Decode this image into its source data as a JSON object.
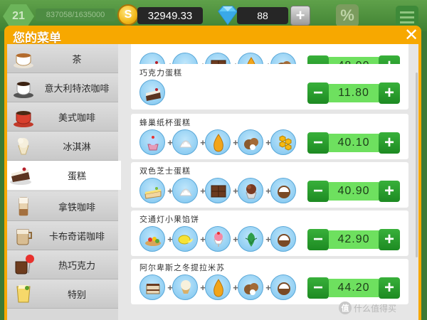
{
  "topbar": {
    "level": "21",
    "xp": "837058/1635000",
    "coins": "32949.33",
    "coin_symbol": "S",
    "gems": "88",
    "plus": "+",
    "percent": "%"
  },
  "dialog": {
    "title": "您的菜单",
    "close": "✕"
  },
  "sidebar": {
    "items": [
      {
        "label": "茶",
        "icon": "tea-cup-icon"
      },
      {
        "label": "意大利特浓咖啡",
        "icon": "espresso-cup-icon"
      },
      {
        "label": "美式咖啡",
        "icon": "coffee-cup-icon"
      },
      {
        "label": "冰淇淋",
        "icon": "ice-cream-icon"
      },
      {
        "label": "蛋糕",
        "icon": "cake-icon",
        "active": true
      },
      {
        "label": "拿铁咖啡",
        "icon": "latte-icon"
      },
      {
        "label": "卡布奇诺咖啡",
        "icon": "cappuccino-icon"
      },
      {
        "label": "热巧克力",
        "icon": "hot-chocolate-icon"
      },
      {
        "label": "特别",
        "icon": "special-drink-icon"
      }
    ]
  },
  "recipes": [
    {
      "name": "",
      "price": "48.90",
      "ingredients": [
        "cake-icon",
        "cream-icon",
        "chocolate-icon",
        "syrup-icon",
        "hazelnut-icon"
      ]
    },
    {
      "name": "巧克力蛋糕",
      "price": "11.80",
      "ingredients": [
        "cake-icon"
      ]
    },
    {
      "name": "蜂巢纸杯蛋糕",
      "price": "40.10",
      "ingredients": [
        "cupcake-icon",
        "cream-icon",
        "syrup-icon",
        "hazelnut-icon",
        "honeycomb-icon"
      ]
    },
    {
      "name": "双色芝士蛋糕",
      "price": "40.90",
      "ingredients": [
        "cheesecake-icon",
        "cream-icon",
        "chocolate-icon",
        "ice-cream-cup-icon",
        "coconut-icon"
      ]
    },
    {
      "name": "交通灯小果馅饼",
      "price": "42.90",
      "ingredients": [
        "tart-icon",
        "lemon-icon",
        "strawberry-sundae-icon",
        "mint-icon",
        "coconut-icon"
      ]
    },
    {
      "name": "阿尔卑斯之冬提拉米苏",
      "price": "44.20",
      "ingredients": [
        "tiramisu-icon",
        "vanilla-ice-cream-icon",
        "syrup-icon",
        "hazelnut-icon",
        "coconut-icon"
      ]
    }
  ],
  "stepper": {
    "minus": "−",
    "plus": "+"
  },
  "watermark": {
    "symbol": "值",
    "text": "什么值得买"
  },
  "colors": {
    "panel": "#f7a800",
    "stepper_button": "#1d8a22",
    "stepper_value": "#6ee05f",
    "ingredient_bg": "#7cc4ef"
  }
}
